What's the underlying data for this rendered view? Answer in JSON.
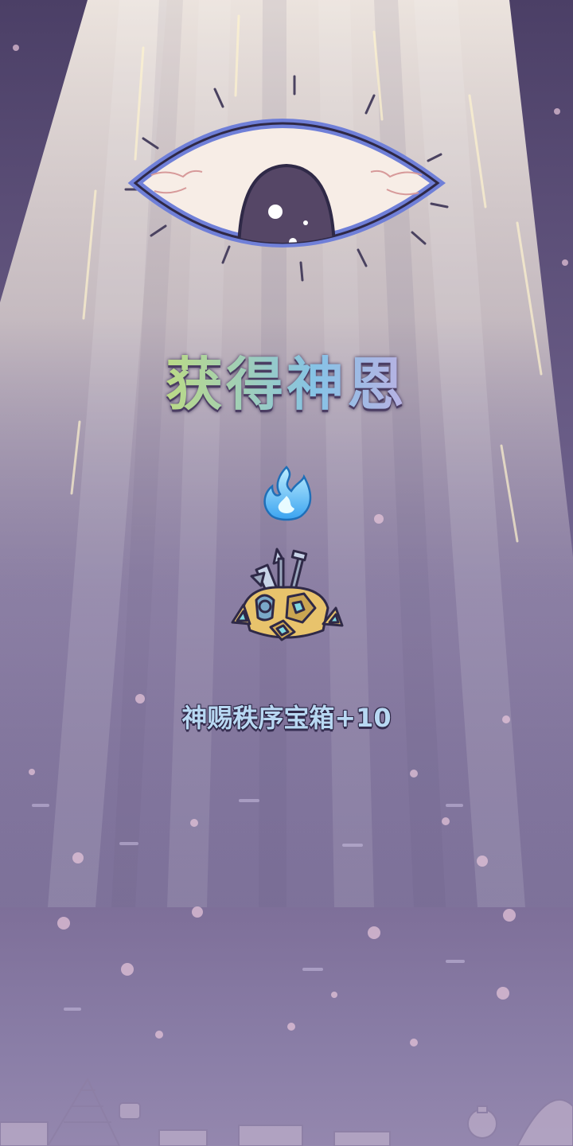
{
  "screen": {
    "title": "获得神恩",
    "reward": {
      "label": "神赐秩序宝箱+10",
      "icon": "treasure-chest-icon"
    },
    "flame_icon": "blue-flame-icon",
    "eye_icon": "divine-eye-icon"
  },
  "colors": {
    "background": "#5c4f78",
    "beam": "#efe3d6",
    "reward_text": "#b8d8f2",
    "title_outline": "#4a3c62",
    "eye_outline": "#6f7fd8"
  }
}
